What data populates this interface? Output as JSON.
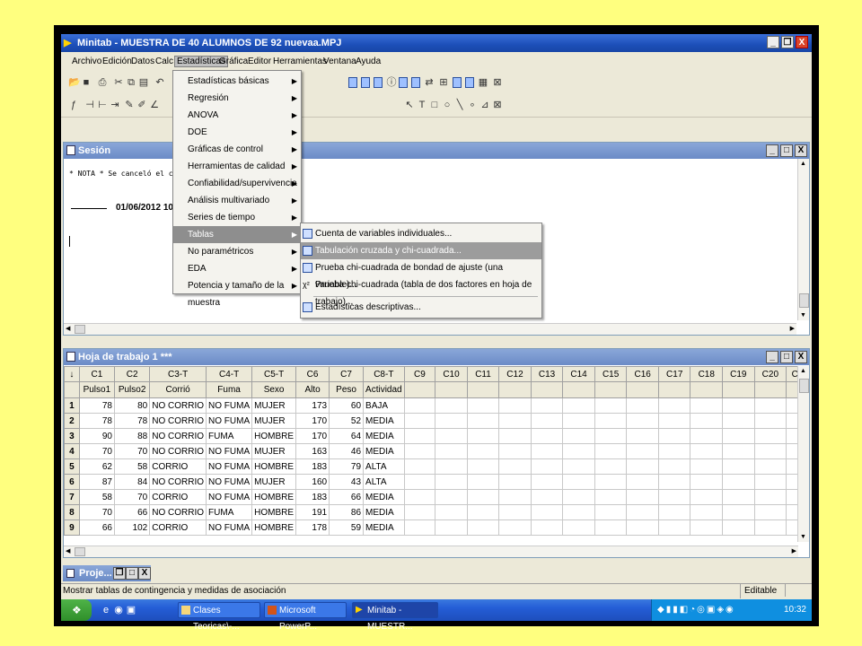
{
  "window": {
    "title": "Minitab - MUESTRA DE 40 ALUMNOS DE 92 nuevaa.MPJ"
  },
  "menubar": [
    "Archivo",
    "Edición",
    "Datos",
    "Calc",
    "Estadísticas",
    "Gráfica",
    "Editor",
    "Herramientas",
    "Ventana",
    "Ayuda"
  ],
  "stats_menu": [
    {
      "label": "Estadísticas básicas",
      "submenu": true
    },
    {
      "label": "Regresión",
      "submenu": true
    },
    {
      "label": "ANOVA",
      "submenu": true
    },
    {
      "label": "DOE",
      "submenu": true
    },
    {
      "label": "Gráficas de control",
      "submenu": true
    },
    {
      "label": "Herramientas de calidad",
      "submenu": true
    },
    {
      "label": "Confiabilidad/supervivencia",
      "submenu": true
    },
    {
      "label": "Análisis multivariado",
      "submenu": true
    },
    {
      "label": "Series de tiempo",
      "submenu": true
    },
    {
      "label": "Tablas",
      "submenu": true,
      "highlighted": true
    },
    {
      "label": "No paramétricos",
      "submenu": true
    },
    {
      "label": "EDA",
      "submenu": true
    },
    {
      "label": "Potencia y tamaño de la muestra",
      "submenu": true
    }
  ],
  "tablas_submenu": [
    {
      "label": "Cuenta de variables individuales...",
      "icon": "table-icon"
    },
    {
      "label": "Tabulación cruzada y chi-cuadrada...",
      "icon": "crosstab-icon",
      "highlighted": true
    },
    {
      "label": "Prueba chi-cuadrada de bondad de ajuste (una variable)...",
      "icon": "bar-icon"
    },
    {
      "label": "Prueba chi-cuadrada (tabla de dos factores en hoja de trabajo)...",
      "icon": "chi-square-icon",
      "glyph": "χ²"
    },
    {
      "label": "Estadísticas descriptivas...",
      "icon": "table-icon"
    }
  ],
  "session": {
    "title": "Sesión",
    "note": "* NOTA * Se canceló el coma",
    "date": "01/06/2012 10:1"
  },
  "worksheet": {
    "title": "Hoja de trabajo 1 ***",
    "corner": "↓",
    "columns": [
      "C1",
      "C2",
      "C3-T",
      "C4-T",
      "C5-T",
      "C6",
      "C7",
      "C8-T",
      "C9",
      "C10",
      "C11",
      "C12",
      "C13",
      "C14",
      "C15",
      "C16",
      "C17",
      "C18",
      "C19",
      "C20",
      "C2"
    ],
    "names": [
      "Pulso1",
      "Pulso2",
      "Corrió",
      "Fuma",
      "Sexo",
      "Alto",
      "Peso",
      "Actividad",
      "",
      "",
      "",
      "",
      "",
      "",
      "",
      "",
      "",
      "",
      "",
      "",
      ""
    ],
    "rows": [
      [
        "1",
        "78",
        "80",
        "NO CORRIO",
        "NO FUMA",
        "MUJER",
        "173",
        "60",
        "BAJA"
      ],
      [
        "2",
        "78",
        "78",
        "NO CORRIO",
        "NO FUMA",
        "MUJER",
        "170",
        "52",
        "MEDIA"
      ],
      [
        "3",
        "90",
        "88",
        "NO CORRIO",
        "FUMA",
        "HOMBRE",
        "170",
        "64",
        "MEDIA"
      ],
      [
        "4",
        "70",
        "70",
        "NO CORRIO",
        "NO FUMA",
        "MUJER",
        "163",
        "46",
        "MEDIA"
      ],
      [
        "5",
        "62",
        "58",
        "CORRIO",
        "NO FUMA",
        "HOMBRE",
        "183",
        "79",
        "ALTA"
      ],
      [
        "6",
        "87",
        "84",
        "NO CORRIO",
        "NO FUMA",
        "MUJER",
        "160",
        "43",
        "ALTA"
      ],
      [
        "7",
        "58",
        "70",
        "CORRIO",
        "NO FUMA",
        "HOMBRE",
        "183",
        "66",
        "MEDIA"
      ],
      [
        "8",
        "70",
        "66",
        "NO CORRIO",
        "FUMA",
        "HOMBRE",
        "191",
        "86",
        "MEDIA"
      ],
      [
        "9",
        "66",
        "102",
        "CORRIO",
        "NO FUMA",
        "HOMBRE",
        "178",
        "59",
        "MEDIA"
      ]
    ]
  },
  "project": {
    "title": "Proje..."
  },
  "status": {
    "message": "Mostrar tablas de contingencia y medidas de asociación",
    "mode": "Editable"
  },
  "taskbar": {
    "tasks": [
      {
        "label": "Clases Teoricas\\-..."
      },
      {
        "label": "Microsoft PowerP..."
      },
      {
        "label": "Minitab - MUESTR...",
        "active": true
      }
    ],
    "clock": "10:32"
  },
  "colors": {
    "background": "#ffff7f",
    "title_active": "#1c4fb8",
    "title_inactive": "#6b8bc7",
    "menu_highlight": "#8e8e8e"
  }
}
